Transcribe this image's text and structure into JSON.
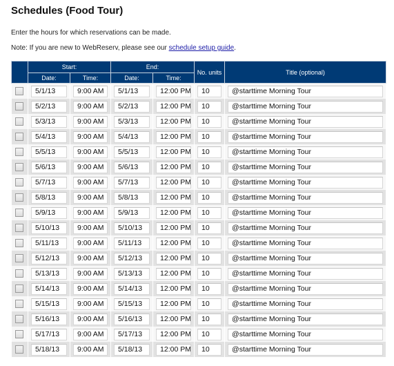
{
  "page": {
    "title": "Schedules (Food Tour)",
    "intro": "Enter the hours for which reservations can be made.",
    "note_prefix": "Note: If you are new to WebReserv, please see our ",
    "note_link": "schedule setup guide",
    "note_suffix": "."
  },
  "table": {
    "headers": {
      "start": "Start:",
      "end": "End:",
      "start_date": "Date:",
      "start_time": "Time:",
      "end_date": "Date:",
      "end_time": "Time:",
      "units": "No. units",
      "title": "Title (optional)"
    },
    "rows": [
      {
        "start_date": "5/1/13",
        "start_time": "9:00 AM",
        "end_date": "5/1/13",
        "end_time": "12:00 PM",
        "units": "10",
        "title": "@starttime Morning Tour",
        "checked": false
      },
      {
        "start_date": "5/2/13",
        "start_time": "9:00 AM",
        "end_date": "5/2/13",
        "end_time": "12:00 PM",
        "units": "10",
        "title": "@starttime Morning Tour",
        "checked": false
      },
      {
        "start_date": "5/3/13",
        "start_time": "9:00 AM",
        "end_date": "5/3/13",
        "end_time": "12:00 PM",
        "units": "10",
        "title": "@starttime Morning Tour",
        "checked": false
      },
      {
        "start_date": "5/4/13",
        "start_time": "9:00 AM",
        "end_date": "5/4/13",
        "end_time": "12:00 PM",
        "units": "10",
        "title": "@starttime Morning Tour",
        "checked": false
      },
      {
        "start_date": "5/5/13",
        "start_time": "9:00 AM",
        "end_date": "5/5/13",
        "end_time": "12:00 PM",
        "units": "10",
        "title": "@starttime Morning Tour",
        "checked": false
      },
      {
        "start_date": "5/6/13",
        "start_time": "9:00 AM",
        "end_date": "5/6/13",
        "end_time": "12:00 PM",
        "units": "10",
        "title": "@starttime Morning Tour",
        "checked": false
      },
      {
        "start_date": "5/7/13",
        "start_time": "9:00 AM",
        "end_date": "5/7/13",
        "end_time": "12:00 PM",
        "units": "10",
        "title": "@starttime Morning Tour",
        "checked": false
      },
      {
        "start_date": "5/8/13",
        "start_time": "9:00 AM",
        "end_date": "5/8/13",
        "end_time": "12:00 PM",
        "units": "10",
        "title": "@starttime Morning Tour",
        "checked": false
      },
      {
        "start_date": "5/9/13",
        "start_time": "9:00 AM",
        "end_date": "5/9/13",
        "end_time": "12:00 PM",
        "units": "10",
        "title": "@starttime Morning Tour",
        "checked": false
      },
      {
        "start_date": "5/10/13",
        "start_time": "9:00 AM",
        "end_date": "5/10/13",
        "end_time": "12:00 PM",
        "units": "10",
        "title": "@starttime Morning Tour",
        "checked": false
      },
      {
        "start_date": "5/11/13",
        "start_time": "9:00 AM",
        "end_date": "5/11/13",
        "end_time": "12:00 PM",
        "units": "10",
        "title": "@starttime Morning Tour",
        "checked": false
      },
      {
        "start_date": "5/12/13",
        "start_time": "9:00 AM",
        "end_date": "5/12/13",
        "end_time": "12:00 PM",
        "units": "10",
        "title": "@starttime Morning Tour",
        "checked": false
      },
      {
        "start_date": "5/13/13",
        "start_time": "9:00 AM",
        "end_date": "5/13/13",
        "end_time": "12:00 PM",
        "units": "10",
        "title": "@starttime Morning Tour",
        "checked": false
      },
      {
        "start_date": "5/14/13",
        "start_time": "9:00 AM",
        "end_date": "5/14/13",
        "end_time": "12:00 PM",
        "units": "10",
        "title": "@starttime Morning Tour",
        "checked": false
      },
      {
        "start_date": "5/15/13",
        "start_time": "9:00 AM",
        "end_date": "5/15/13",
        "end_time": "12:00 PM",
        "units": "10",
        "title": "@starttime Morning Tour",
        "checked": false
      },
      {
        "start_date": "5/16/13",
        "start_time": "9:00 AM",
        "end_date": "5/16/13",
        "end_time": "12:00 PM",
        "units": "10",
        "title": "@starttime Morning Tour",
        "checked": false
      },
      {
        "start_date": "5/17/13",
        "start_time": "9:00 AM",
        "end_date": "5/17/13",
        "end_time": "12:00 PM",
        "units": "10",
        "title": "@starttime Morning Tour",
        "checked": false
      },
      {
        "start_date": "5/18/13",
        "start_time": "9:00 AM",
        "end_date": "5/18/13",
        "end_time": "12:00 PM",
        "units": "10",
        "title": "@starttime Morning Tour",
        "checked": false
      }
    ]
  },
  "colors": {
    "header_bg": "#003a75",
    "link": "#1a1aa6",
    "row_light": "#f7f7f7",
    "row_dark": "#e2e2e2"
  }
}
